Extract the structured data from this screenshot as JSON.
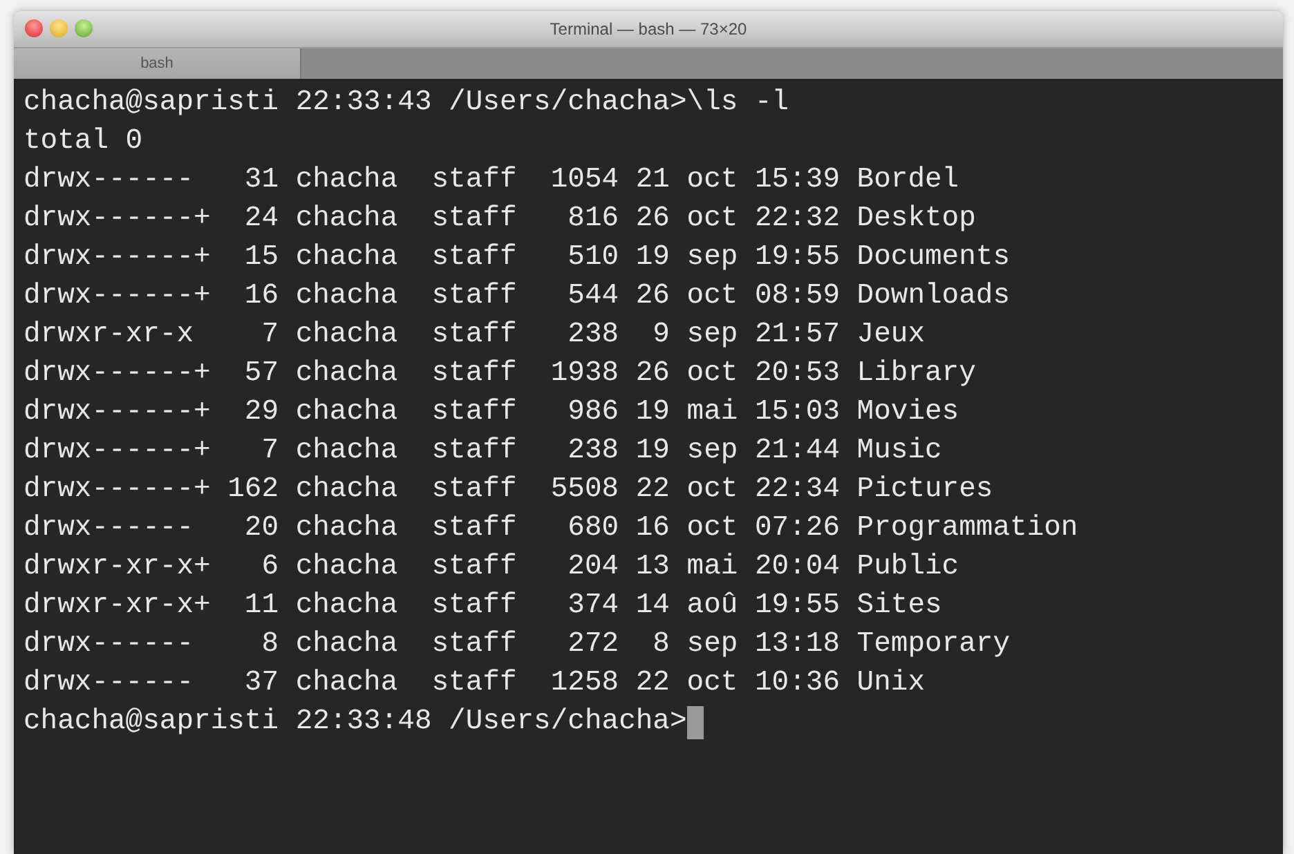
{
  "window": {
    "title": "Terminal — bash — 73×20"
  },
  "tabs": [
    {
      "label": "bash",
      "selected": true
    }
  ],
  "terminal": {
    "lines": [
      "chacha@sapristi 22:33:43 /Users/chacha>\\ls -l",
      "total 0",
      "drwx------   31 chacha  staff  1054 21 oct 15:39 Bordel",
      "drwx------+  24 chacha  staff   816 26 oct 22:32 Desktop",
      "drwx------+  15 chacha  staff   510 19 sep 19:55 Documents",
      "drwx------+  16 chacha  staff   544 26 oct 08:59 Downloads",
      "drwxr-xr-x    7 chacha  staff   238  9 sep 21:57 Jeux",
      "drwx------+  57 chacha  staff  1938 26 oct 20:53 Library",
      "drwx------+  29 chacha  staff   986 19 mai 15:03 Movies",
      "drwx------+   7 chacha  staff   238 19 sep 21:44 Music",
      "drwx------+ 162 chacha  staff  5508 22 oct 22:34 Pictures",
      "drwx------   20 chacha  staff   680 16 oct 07:26 Programmation",
      "drwxr-xr-x+   6 chacha  staff   204 13 mai 20:04 Public",
      "drwxr-xr-x+  11 chacha  staff   374 14 aoû 19:55 Sites",
      "drwx------    8 chacha  staff   272  8 sep 13:18 Temporary",
      "drwx------   37 chacha  staff  1258 22 oct 10:36 Unix"
    ],
    "prompt": "chacha@sapristi 22:33:48 /Users/chacha>",
    "cursor_visible": true
  }
}
